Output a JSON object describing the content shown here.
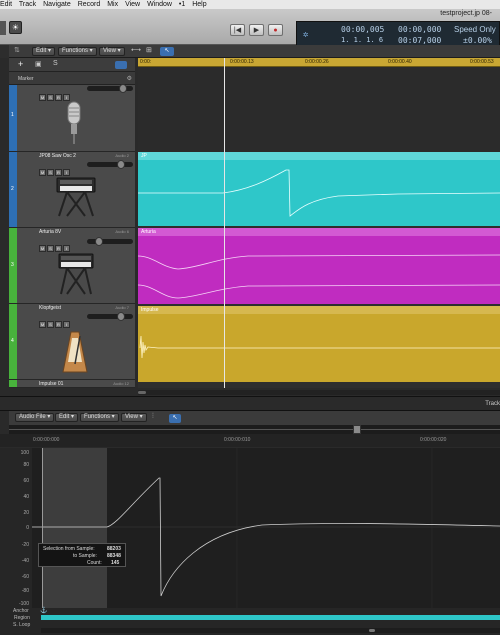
{
  "menubar": {
    "items": [
      "Edit",
      "Track",
      "Navigate",
      "Record",
      "Mix",
      "View",
      "Window",
      "•1",
      "Help"
    ]
  },
  "window": {
    "title": "testproject.jp 08-"
  },
  "transport": {
    "rewind": "|◀",
    "play": "▶",
    "record": "●"
  },
  "lcd": {
    "time": "00:00,005",
    "bars": "1.  1.  1.     6",
    "end_time": "00:00,000",
    "length": "00:07,000",
    "speed_label": "Speed Only",
    "speed_value": "±0.00%"
  },
  "arrange_toolbar": {
    "edit": "Edit",
    "functions": "Functions",
    "view": "View"
  },
  "ruler": {
    "ticks": [
      "0:00:",
      "0:00:00.13",
      "0:00:00.26",
      "0:00:00.40",
      "0:00:00.53"
    ]
  },
  "tracklist": {
    "marker_label": "Marker"
  },
  "tracks": [
    {
      "num": "1",
      "name": "",
      "output": "",
      "color": "#2e6fb4",
      "icon": "microphone-icon"
    },
    {
      "num": "2",
      "name": "JP08 Saw Osc 2",
      "output": "Audio 2",
      "color": "#2e6fb4",
      "icon": "synthesizer-icon"
    },
    {
      "num": "3",
      "name": "Arturia 8V",
      "output": "Audio 6",
      "color": "#48b23c",
      "icon": "keyboard-icon"
    },
    {
      "num": "4",
      "name": "Klopfgeist",
      "output": "Audio 7",
      "color": "#48b23c",
      "icon": "metronome-icon"
    },
    {
      "num": "5",
      "name": "Impulse 01",
      "output": "Audio 12",
      "color": "#48b23c",
      "icon": ""
    }
  ],
  "track_buttons": {
    "mute": "M",
    "solo": "S",
    "rec": "R",
    "input": "I"
  },
  "regions": [
    {
      "name": "JP",
      "color": "#2ec7c9"
    },
    {
      "name": "Arturia",
      "color": "#c02cc0"
    },
    {
      "name": "Impulse",
      "color": "#c9a72c"
    }
  ],
  "editor_tab": "Track",
  "editor_toolbar": {
    "audio_file": "Audio File",
    "edit": "Edit",
    "functions": "Functions",
    "view": "View"
  },
  "editor_ruler": {
    "ticks": [
      "0:00:00:000",
      "0:00:00:010",
      "0:00:00:020"
    ]
  },
  "amplitude_axis": {
    "ticks": [
      "100",
      "80",
      "60",
      "40",
      "20",
      "0",
      "-20",
      "-40",
      "-60",
      "-80",
      "-100"
    ]
  },
  "selection_info": {
    "from_label": "Selection from Sample:",
    "from_value": "88203",
    "to_label": "to Sample:",
    "to_value": "88348",
    "count_label": "Count:",
    "count_value": "145"
  },
  "bottom_labels": {
    "anchor": "Anchor",
    "region": "Region",
    "s_loop": "S. Loop"
  }
}
